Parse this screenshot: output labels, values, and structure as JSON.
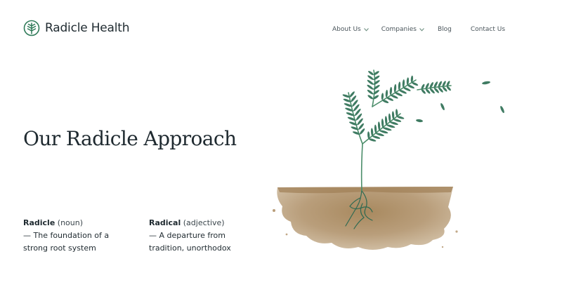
{
  "brand": {
    "name": "Radicle Health",
    "logo_icon": "leaf-logo-icon",
    "accent_color": "#2f7a58"
  },
  "nav": {
    "items": [
      {
        "label": "About Us",
        "has_dropdown": true
      },
      {
        "label": "Companies",
        "has_dropdown": true
      },
      {
        "label": "Blog",
        "has_dropdown": false
      },
      {
        "label": "Contact Us",
        "has_dropdown": false
      }
    ]
  },
  "hero": {
    "title": "Our Radicle Approach"
  },
  "definitions": [
    {
      "term": "Radicle",
      "part_of_speech": "(noun)",
      "line1": "— The foundation of a",
      "line2": "strong root system"
    },
    {
      "term": "Radical",
      "part_of_speech": "(adjective)",
      "line1": "— A departure from",
      "line2": "tradition, unorthodox"
    }
  ],
  "illustration": {
    "subject": "seedling-in-soil-illustration",
    "leaf_color": "#3f7b62",
    "soil_color": "#b79b78"
  }
}
